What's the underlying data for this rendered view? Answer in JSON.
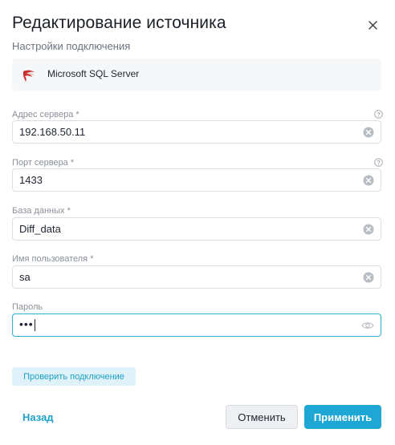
{
  "dialog": {
    "title": "Редактирование источника",
    "close_icon": "close-icon"
  },
  "section": {
    "subtitle": "Настройки подключения"
  },
  "source": {
    "name": "Microsoft SQL Server",
    "icon": "mssql-logo-icon"
  },
  "fields": {
    "server_address": {
      "label": "Адрес сервера *",
      "value": "192.168.50.11",
      "has_help": true
    },
    "server_port": {
      "label": "Порт сервера *",
      "value": "1433",
      "has_help": true
    },
    "database": {
      "label": "База данных *",
      "value": "Diff_data"
    },
    "username": {
      "label": "Имя пользователя *",
      "value": "sa"
    },
    "password": {
      "label": "Пароль",
      "masked_value": "•••",
      "icon": "eye-icon"
    }
  },
  "actions": {
    "test_connection": "Проверить подключение",
    "back": "Назад",
    "cancel": "Отменить",
    "apply": "Применить"
  },
  "colors": {
    "accent": "#1ea7d4",
    "focus_border": "#2bb0d6",
    "secondary_button_bg": "#eef0f3",
    "test_button_bg": "#dff2f9"
  }
}
